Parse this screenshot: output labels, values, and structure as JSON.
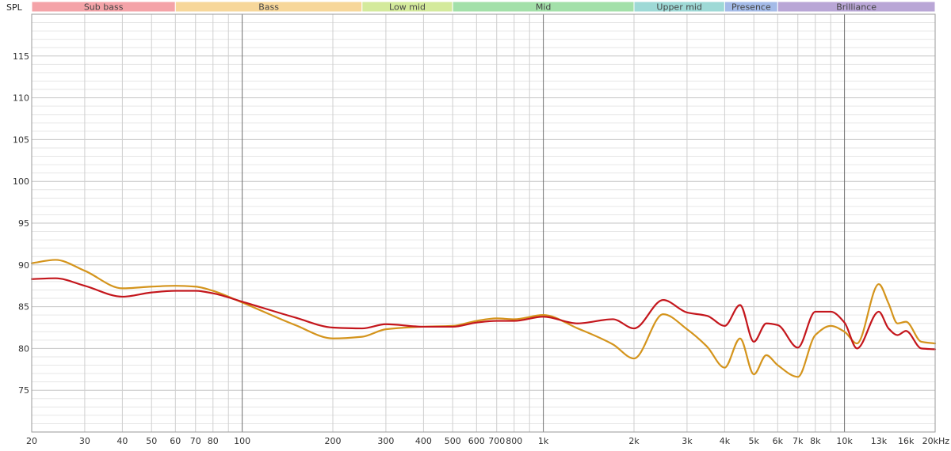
{
  "chart_data": {
    "type": "line",
    "ylabel": "SPL",
    "x_scale": "log",
    "xlim": [
      20,
      20000
    ],
    "ylim": [
      70,
      120
    ],
    "grid": true,
    "x_ticks": [
      {
        "value": 20,
        "label": "20",
        "muted": false
      },
      {
        "value": 30,
        "label": "30",
        "muted": false
      },
      {
        "value": 40,
        "label": "40",
        "muted": false
      },
      {
        "value": 50,
        "label": "50",
        "muted": false
      },
      {
        "value": 60,
        "label": "60",
        "muted": false
      },
      {
        "value": 70,
        "label": "70",
        "muted": false
      },
      {
        "value": 80,
        "label": "80",
        "muted": false
      },
      {
        "value": 100,
        "label": "100",
        "muted": false
      },
      {
        "value": 200,
        "label": "200",
        "muted": false
      },
      {
        "value": 300,
        "label": "300",
        "muted": false
      },
      {
        "value": 400,
        "label": "400",
        "muted": false
      },
      {
        "value": 500,
        "label": "500",
        "muted": false
      },
      {
        "value": 600,
        "label": "600",
        "muted": false
      },
      {
        "value": 700,
        "label": "700",
        "muted": false
      },
      {
        "value": 800,
        "label": "800",
        "muted": false
      },
      {
        "value": 1000,
        "label": "1k",
        "muted": false
      },
      {
        "value": 2000,
        "label": "2k",
        "muted": false
      },
      {
        "value": 3000,
        "label": "3k",
        "muted": false
      },
      {
        "value": 4000,
        "label": "4k",
        "muted": false
      },
      {
        "value": 5000,
        "label": "5k",
        "muted": false
      },
      {
        "value": 6000,
        "label": "6k",
        "muted": false
      },
      {
        "value": 7000,
        "label": "7k",
        "muted": false
      },
      {
        "value": 8000,
        "label": "8k",
        "muted": false
      },
      {
        "value": 10000,
        "label": "10k",
        "muted": false
      },
      {
        "value": 13000,
        "label": "13k",
        "muted": true
      },
      {
        "value": 16000,
        "label": "16k",
        "muted": true
      },
      {
        "value": 20000,
        "label": "20kHz",
        "muted": false
      }
    ],
    "y_ticks": [
      75,
      80,
      85,
      90,
      95,
      100,
      105,
      110,
      115
    ],
    "bands": [
      {
        "label": "Sub bass",
        "from": 20,
        "to": 60,
        "color": "#f4a3a8"
      },
      {
        "label": "Bass",
        "from": 60,
        "to": 250,
        "color": "#f7d79a"
      },
      {
        "label": "Low mid",
        "from": 250,
        "to": 500,
        "color": "#d4ea9c"
      },
      {
        "label": "Mid",
        "from": 500,
        "to": 2000,
        "color": "#a3e0a9"
      },
      {
        "label": "Upper mid",
        "from": 2000,
        "to": 4000,
        "color": "#9ed9d6"
      },
      {
        "label": "Presence",
        "from": 4000,
        "to": 6000,
        "color": "#a4bbe8"
      },
      {
        "label": "Brilliance",
        "from": 6000,
        "to": 20000,
        "color": "#b9a6d6"
      }
    ],
    "series": [
      {
        "color": "#d4941c",
        "x": [
          20,
          24,
          30,
          40,
          50,
          60,
          70,
          80,
          100,
          150,
          200,
          250,
          300,
          400,
          500,
          600,
          700,
          800,
          1000,
          1300,
          1700,
          2000,
          2500,
          3000,
          3500,
          4000,
          4500,
          5000,
          5500,
          6000,
          7000,
          8000,
          9000,
          10000,
          11000,
          13000,
          14000,
          15000,
          16000,
          18000,
          20000
        ],
        "y": [
          90.2,
          90.6,
          89.3,
          87.2,
          87.4,
          87.5,
          87.4,
          86.9,
          85.5,
          82.8,
          81.2,
          81.4,
          82.3,
          82.6,
          82.7,
          83.3,
          83.6,
          83.5,
          84.0,
          82.4,
          80.5,
          78.8,
          84.1,
          82.3,
          80.2,
          77.7,
          81.2,
          76.9,
          79.2,
          78.0,
          76.6,
          81.6,
          82.7,
          82.0,
          80.6,
          87.7,
          85.4,
          83.0,
          83.2,
          80.8,
          80.6
        ]
      },
      {
        "color": "#c4161c",
        "x": [
          20,
          24,
          30,
          40,
          50,
          60,
          70,
          80,
          100,
          150,
          200,
          250,
          300,
          400,
          500,
          600,
          700,
          800,
          1000,
          1300,
          1700,
          2000,
          2500,
          3000,
          3500,
          4000,
          4500,
          5000,
          5500,
          6000,
          7000,
          8000,
          9000,
          10000,
          11000,
          13000,
          14000,
          15000,
          16000,
          18000,
          20000
        ],
        "y": [
          88.3,
          88.4,
          87.5,
          86.2,
          86.7,
          86.9,
          86.9,
          86.6,
          85.6,
          83.7,
          82.5,
          82.4,
          82.9,
          82.6,
          82.6,
          83.1,
          83.3,
          83.3,
          83.8,
          83.0,
          83.5,
          82.4,
          85.8,
          84.3,
          83.9,
          82.7,
          85.2,
          80.8,
          83.0,
          82.8,
          80.1,
          84.4,
          84.4,
          83.1,
          80.0,
          84.4,
          82.4,
          81.6,
          82.1,
          80.0,
          79.9
        ]
      }
    ]
  }
}
